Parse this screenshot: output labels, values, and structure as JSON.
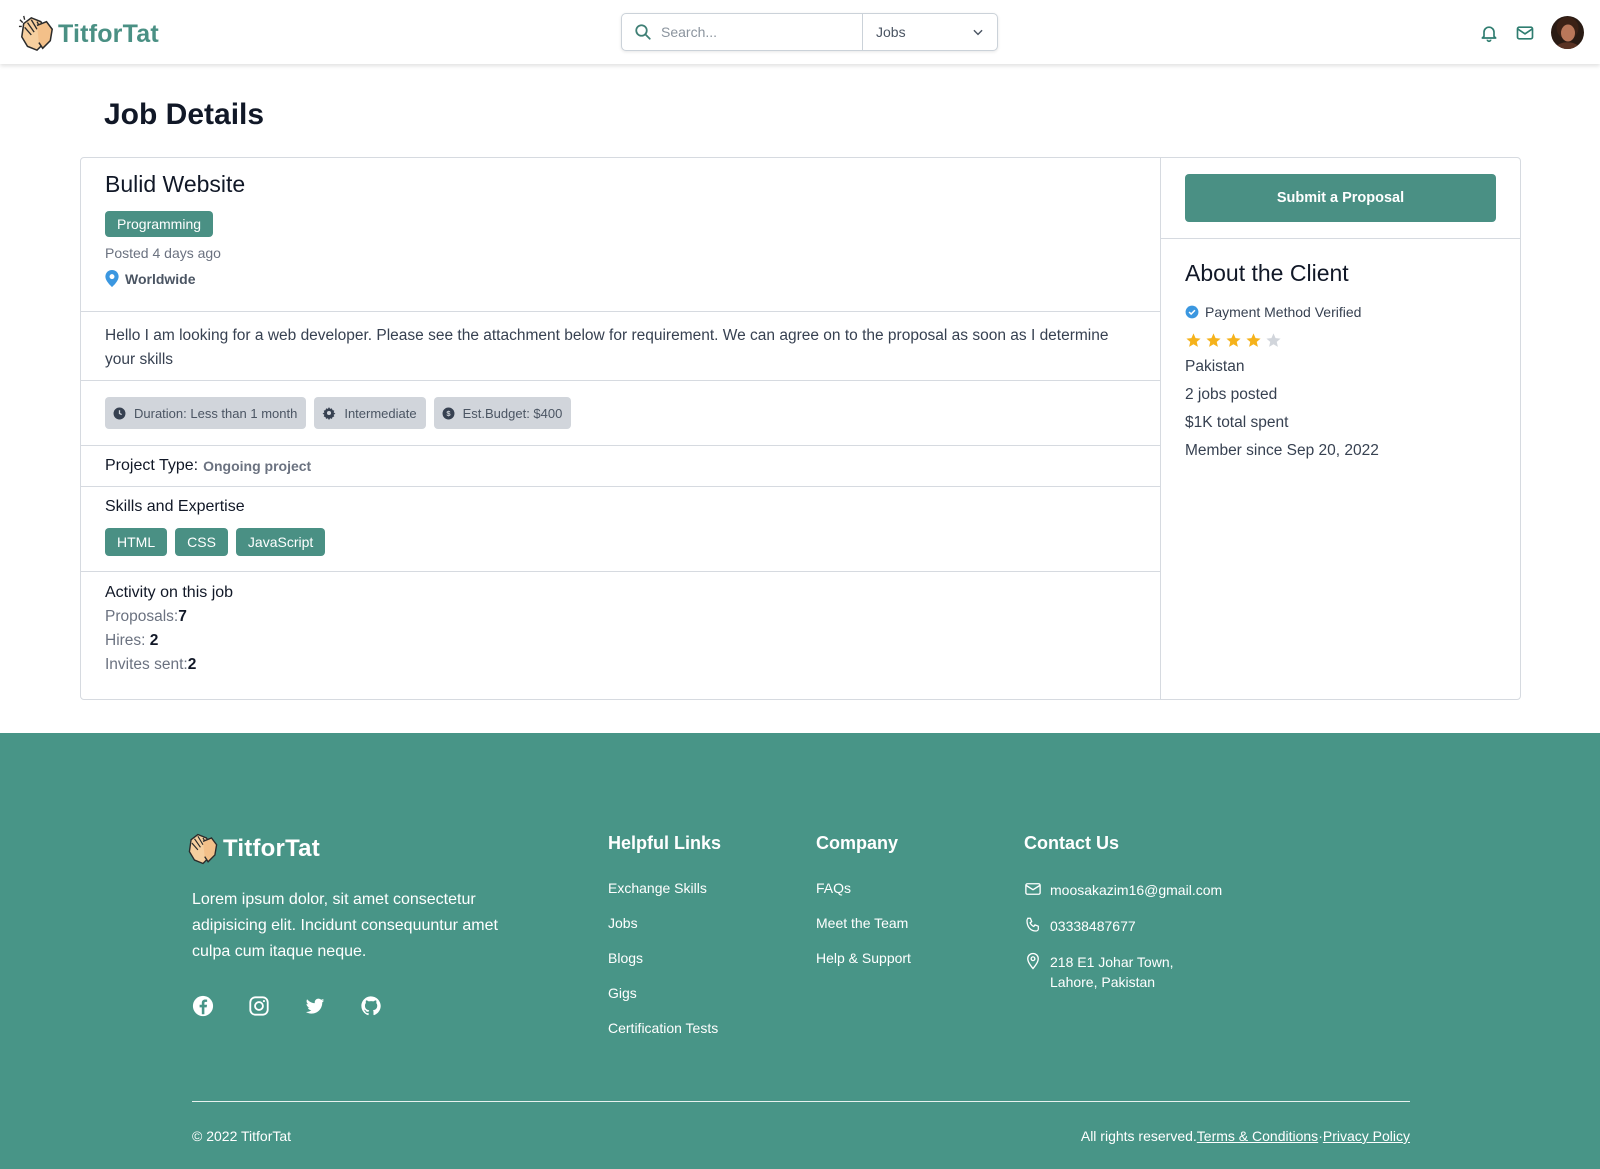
{
  "brand": {
    "name": "TitforTat",
    "color": "#4a9084"
  },
  "nav": {
    "search_placeholder": "Search...",
    "search_category": "Jobs"
  },
  "page_title": "Job Details",
  "job": {
    "title": "Bulid Website",
    "category": "Programming",
    "posted": "Posted 4 days ago",
    "location": "Worldwide",
    "description": "Hello I am looking for a web developer. Please see the attachment below for requirement. We can agree on to the proposal as soon as I determine your skills",
    "meta": {
      "duration": "Duration: Less than 1 month",
      "level": "Intermediate",
      "budget": "Est.Budget: $400"
    },
    "project_type_label": "Project Type:",
    "project_type_value": "Ongoing project",
    "skills_heading": "Skills and Expertise",
    "skills": [
      "HTML",
      "CSS",
      "JavaScript"
    ],
    "activity_heading": "Activity on this job",
    "activity": {
      "proposals_label": "Proposals:",
      "proposals_value": "7",
      "hires_label": "Hires: ",
      "hires_value": "2",
      "invites_label": "Invites sent:",
      "invites_value": "2"
    }
  },
  "sidebar": {
    "submit_label": "Submit a Proposal",
    "about_heading": "About the Client",
    "verified": "Payment Method Verified",
    "rating": 4,
    "rating_max": 5,
    "country": "Pakistan",
    "jobs_posted": "2 jobs posted",
    "total_spent": "$1K total spent",
    "member_since": "Member since Sep 20, 2022"
  },
  "footer": {
    "brand": "TitforTat",
    "description": "Lorem ipsum dolor, sit amet consectetur adipisicing elit. Incidunt consequuntur amet culpa cum itaque neque.",
    "helpful_heading": "Helpful Links",
    "helpful_links": [
      "Exchange Skills",
      "Jobs",
      "Blogs",
      "Gigs",
      "Certification Tests"
    ],
    "company_heading": "Company",
    "company_links": [
      "FAQs",
      "Meet the Team",
      "Help & Support"
    ],
    "contact_heading": "Contact Us",
    "email": "moosakazim16@gmail.com",
    "phone": "03338487677",
    "address_line1": "218 E1 Johar Town,",
    "address_line2": "Lahore, Pakistan",
    "copyright": "© 2022 TitforTat",
    "rights": "All rights reserved.",
    "terms": "Terms & Conditions",
    "separator": "·",
    "privacy": "Privacy Policy"
  },
  "colors": {
    "accent": "#4a9084",
    "footer_bg": "#489587",
    "star": "#f5b21b",
    "star_empty": "#d1d5db",
    "verified_blue": "#3b97e0"
  }
}
